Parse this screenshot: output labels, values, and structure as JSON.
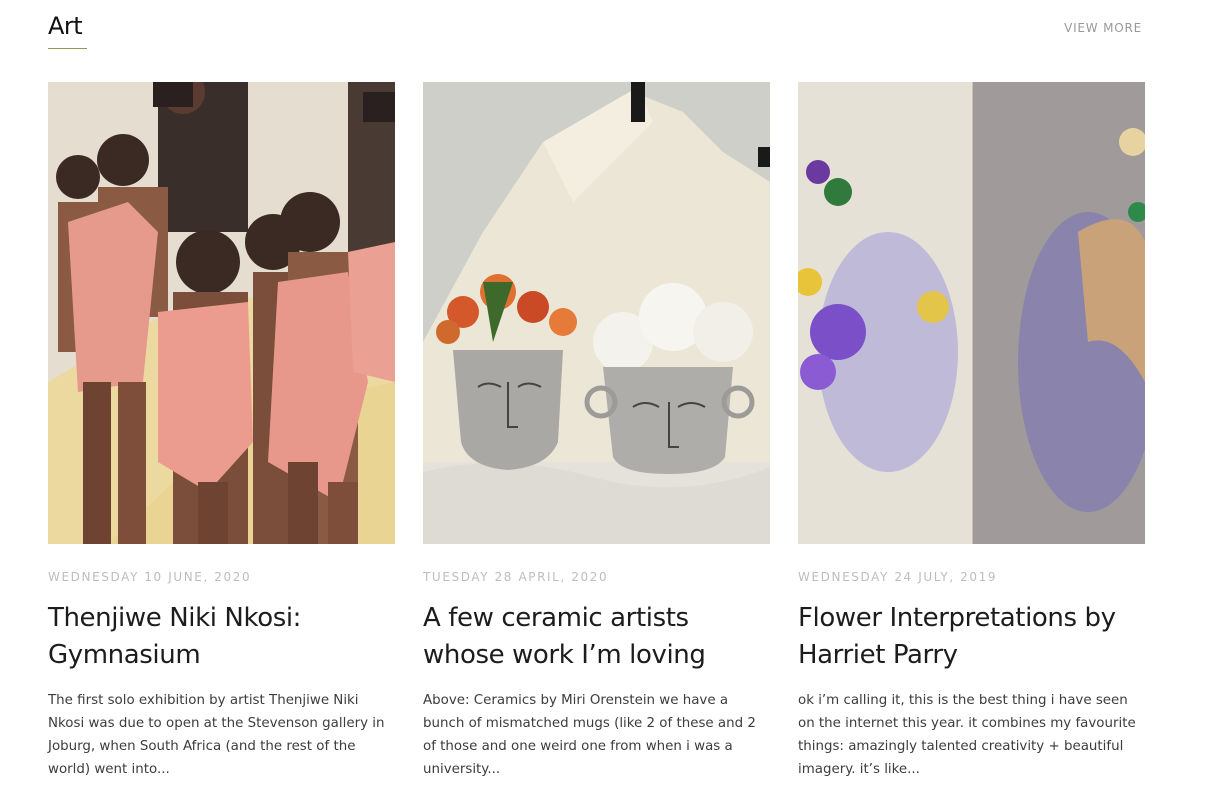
{
  "section": {
    "title": "Art",
    "view_more": "VIEW MORE",
    "accent_color": "#8a9a5b"
  },
  "posts": [
    {
      "date": "WEDNESDAY 10 JUNE, 2020",
      "title": "Thenjiwe Niki Nkosi: Gymnasium",
      "excerpt": "The first solo exhibition by artist Thenjiwe Niki Nkosi was due to open at the Stevenson gallery in Joburg, when South Africa (and the rest of the world) went into...",
      "image": "painting of gymnasts in pink leotards"
    },
    {
      "date": "TUESDAY 28 APRIL, 2020",
      "title": "A few ceramic artists whose work I’m loving",
      "excerpt": "Above: Ceramics by Miri Orenstein we have a bunch of mismatched mugs (like 2 of these and 2 of those and one weird one from when i was a university...",
      "image": "two ceramic face vases with flowers"
    },
    {
      "date": "WEDNESDAY 24 JULY, 2019",
      "title": "Flower Interpretations by Harriet Parry",
      "excerpt": "ok i’m calling it, this is the best thing i have seen on the internet this year. it combines my favourite things: amazingly talented creativity + beautiful imagery. it’s like...",
      "image": "flower arrangement beside impressionist painting"
    }
  ]
}
